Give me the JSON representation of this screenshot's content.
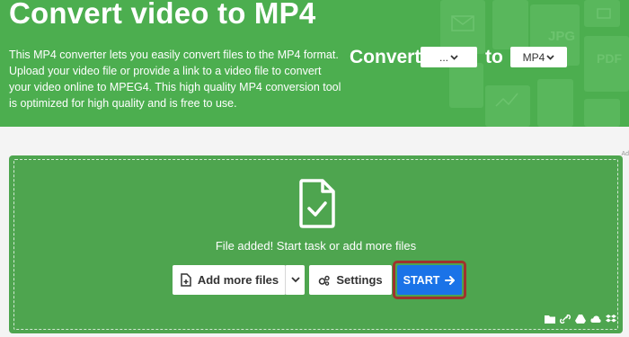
{
  "header": {
    "title": "Convert video to MP4",
    "description": "This MP4 converter lets you easily convert files to the MP4 format. Upload your video file or provide a link to a video file to convert your video online to MPEG4. This high quality MP4 conversion tool is optimized for high quality and is free to use.",
    "background_text": [
      "JPG",
      "PDF"
    ]
  },
  "converter": {
    "convert_label": "Convert",
    "from_value": "...",
    "to_label": "to",
    "to_value": "MP4"
  },
  "ad_marker": "Ad",
  "upload": {
    "status_text": "File added! Start task or add more files",
    "add_files_label": "Add more files",
    "settings_label": "Settings",
    "start_label": "START",
    "source_icons": [
      "folder-icon",
      "link-icon",
      "google-drive-icon",
      "cloud-icon",
      "dropbox-icon"
    ]
  },
  "colors": {
    "hero_green": "#4cae4f",
    "dropzone_green": "#4ea54f",
    "start_blue": "#1a73e8",
    "highlight_red": "#a0322d"
  }
}
